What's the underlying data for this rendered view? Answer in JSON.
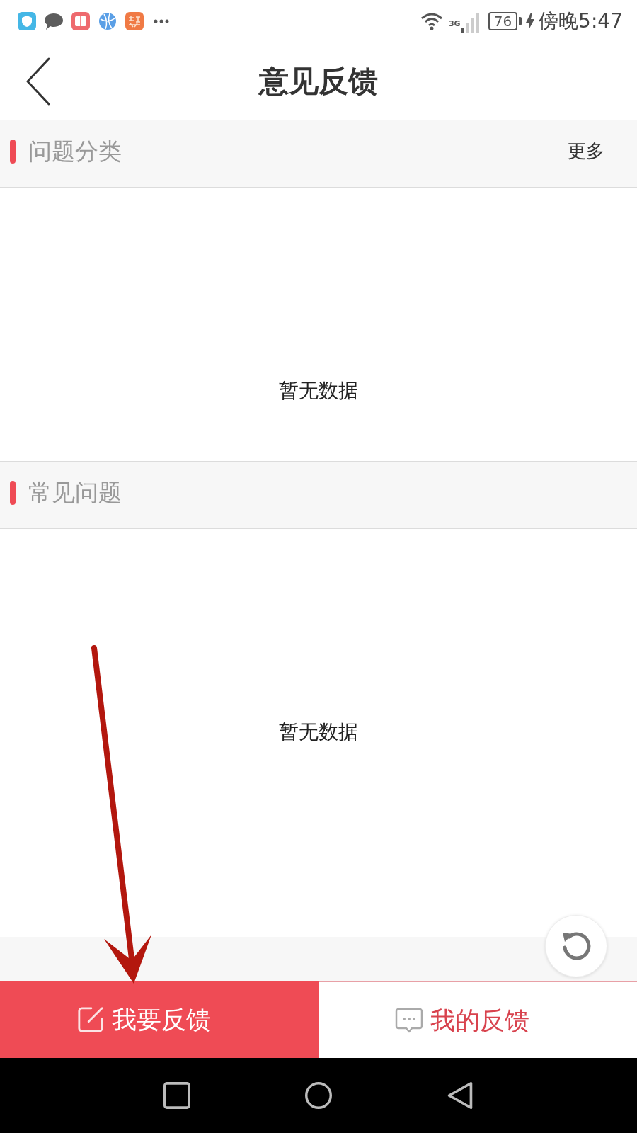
{
  "status_bar": {
    "network": "3G",
    "battery": "76",
    "time": "傍晚5:47"
  },
  "header": {
    "title": "意见反馈"
  },
  "sections": [
    {
      "title": "问题分类",
      "more": "更多",
      "empty_text": "暂无数据"
    },
    {
      "title": "常见问题",
      "empty_text": "暂无数据"
    }
  ],
  "bottom_tabs": [
    {
      "label": "我要反馈",
      "kind": "compose",
      "selected": true
    },
    {
      "label": "我的反馈",
      "kind": "messages",
      "selected": false
    }
  ]
}
